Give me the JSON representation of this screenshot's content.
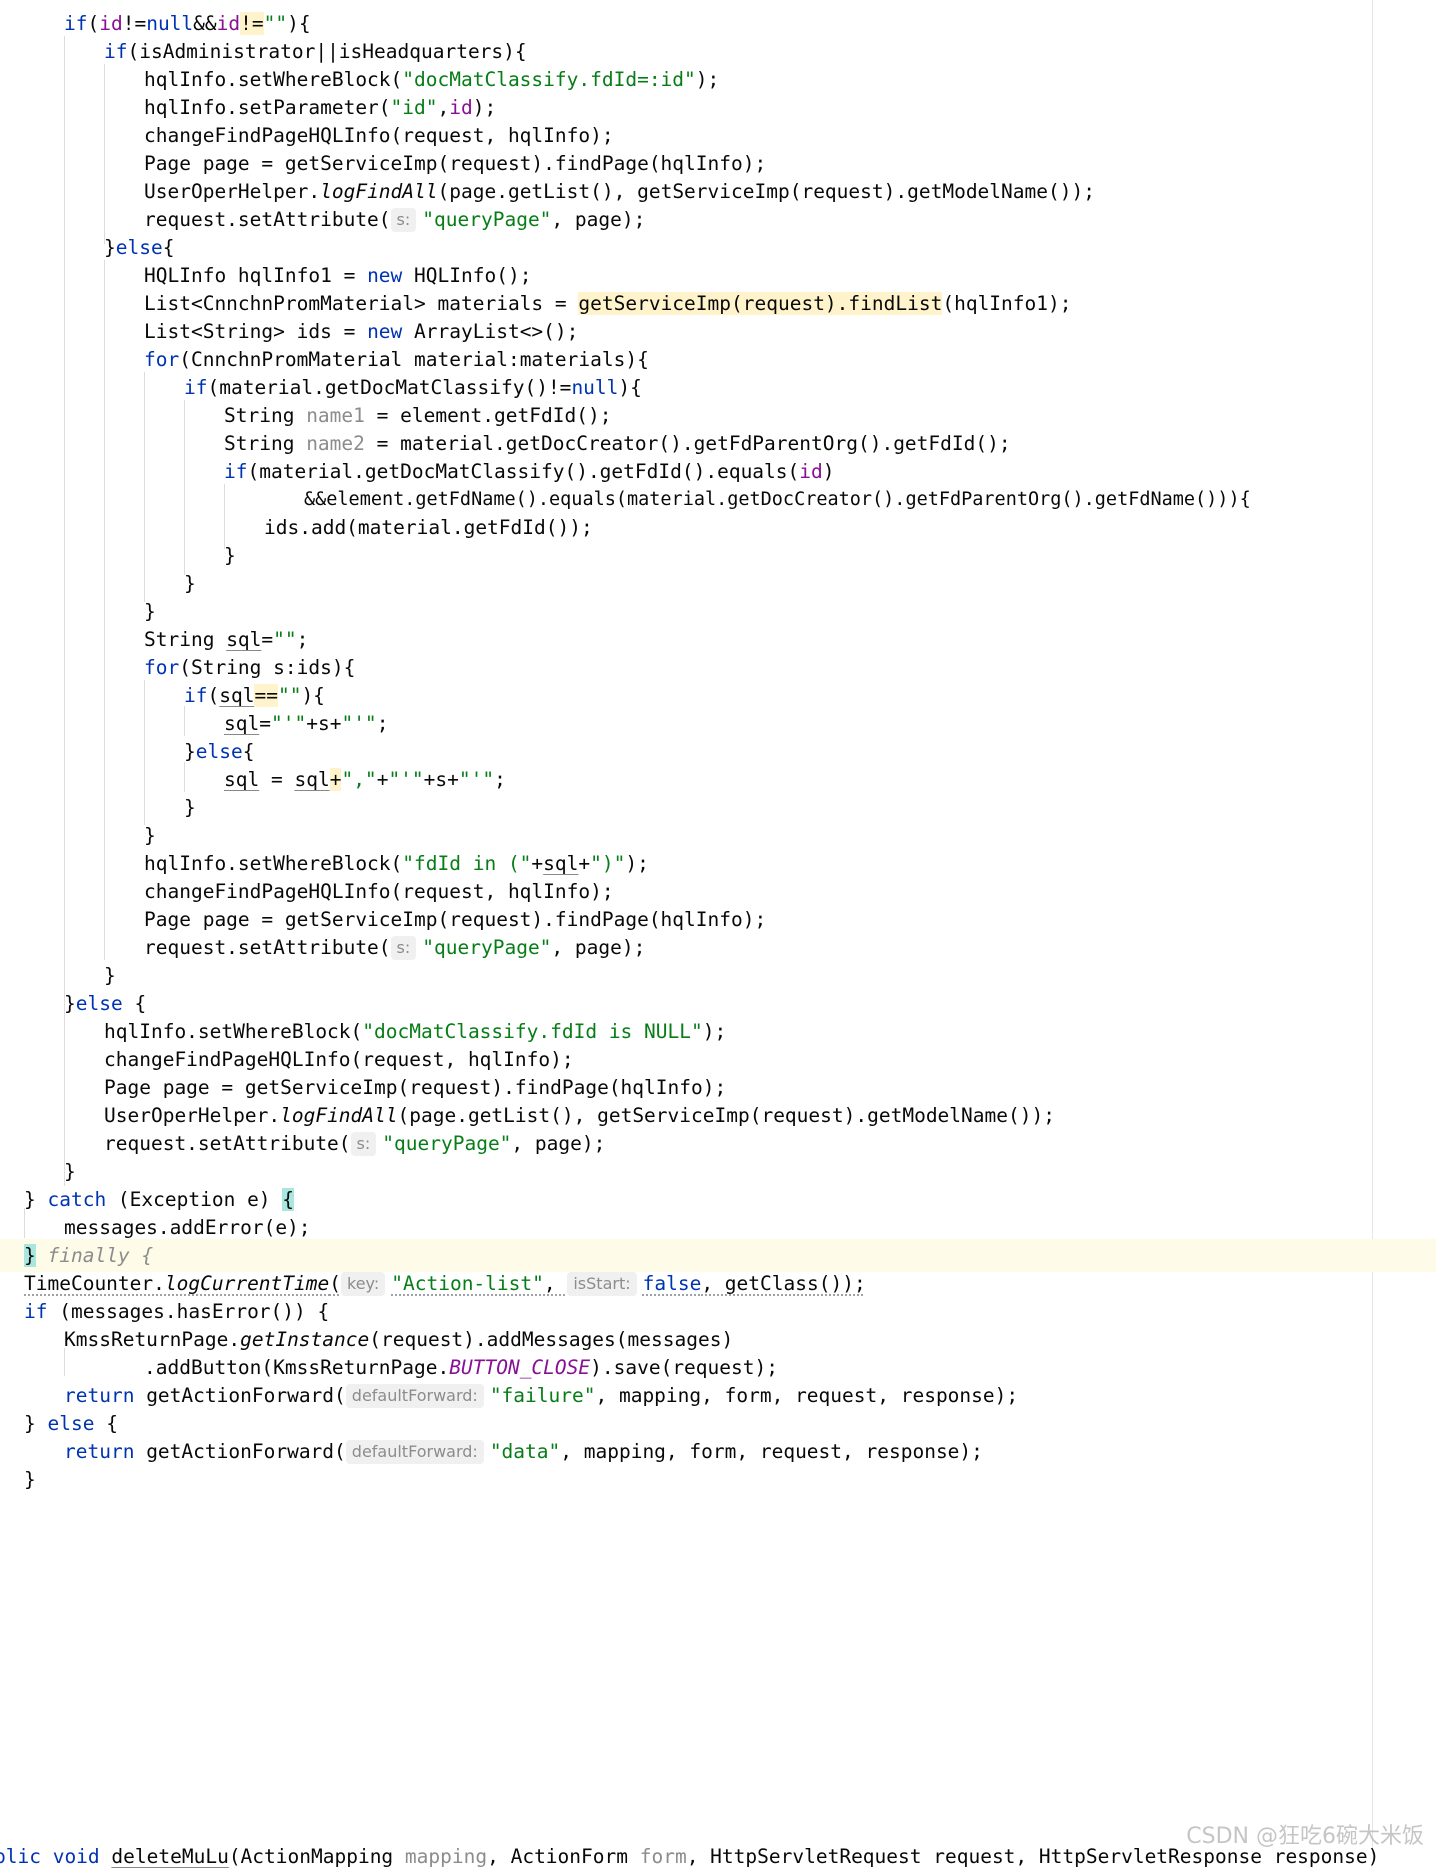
{
  "code": {
    "l0": "if(id!=null&&id!=\"\"){",
    "l1_kw": "if",
    "l1": "(isAdministrator||isHeadquarters){",
    "l2a": "hqlInfo.setWhereBlock(",
    "l2s": "\"docMatClassify.fdId=:id\"",
    "l2b": ");",
    "l3a": "hqlInfo.setParameter(",
    "l3s": "\"id\"",
    "l3b": ",",
    "l3f": "id",
    "l3c": ");",
    "l4": "changeFindPageHQLInfo(request, hqlInfo);",
    "l5": "Page page = getServiceImp(request).findPage(hqlInfo);",
    "l6a": "UserOperHelper.",
    "l6i": "logFindAll",
    "l6b": "(page.getList(), getServiceImp(request).getModelName());",
    "l7a": "request.setAttribute(",
    "l7h": "s:",
    "l7s": "\"queryPage\"",
    "l7b": ", page);",
    "l8a": "}",
    "l8k": "else",
    "l8b": "{",
    "l9a": "HQLInfo hqlInfo1 = ",
    "l9k": "new",
    "l9b": " HQLInfo();",
    "l10a": "List<CnnchnPromMaterial> materials = ",
    "l10h": "getServiceImp(request).findList",
    "l10b": "(hqlInfo1);",
    "l11a": "List<String> ids = ",
    "l11k": "new",
    "l11b": " ArrayList<>();",
    "l12k": "for",
    "l12": "(CnnchnPromMaterial material:materials){",
    "l13k": "if",
    "l13a": "(material.getDocMatClassify()!=",
    "l13n": "null",
    "l13b": "){",
    "l14a": "String ",
    "l14u": "name1",
    "l14b": " = element.getFdId();",
    "l15a": "String ",
    "l15u": "name2",
    "l15b": " = material.getDocCreator().getFdParentOrg().getFdId();",
    "l16k": "if",
    "l16a": "(material.getDocMatClassify().getFdId().equals(",
    "l16f": "id",
    "l16b": ")",
    "l17": "&&element.getFdName().equals(material.getDocCreator().getFdParentOrg().getFdName())){",
    "l18": "ids.add(material.getFdId());",
    "l19": "}",
    "l20": "}",
    "l21": "}",
    "l22a": "String ",
    "l22v": "sql",
    "l22b": "=",
    "l22s": "\"\"",
    "l22c": ";",
    "l23k": "for",
    "l23": "(String s:ids){",
    "l24k": "if",
    "l24a": "(",
    "l24v": "sql",
    "l24e": "==",
    "l24s": "\"\"",
    "l24b": "){",
    "l25v": "sql",
    "l25a": "=",
    "l25s1": "\"'\"",
    "l25b": "+s+",
    "l25s2": "\"'\"",
    "l25c": ";",
    "l26a": "}",
    "l26k": "else",
    "l26b": "{",
    "l27v": "sql",
    "l27a": " = ",
    "l27v2": "sql",
    "l27p": "+",
    "l27s1": "\",\"",
    "l27b": "+",
    "l27s2": "\"'\"",
    "l27c": "+s+",
    "l27s3": "\"'\"",
    "l27d": ";",
    "l28": "}",
    "l29": "}",
    "l30a": "hqlInfo.setWhereBlock(",
    "l30s1": "\"fdId in (\"",
    "l30b": "+",
    "l30v": "sql",
    "l30c": "+",
    "l30s2": "\")\"",
    "l30d": ");",
    "l31": "changeFindPageHQLInfo(request, hqlInfo);",
    "l32": "Page page = getServiceImp(request).findPage(hqlInfo);",
    "l33a": "request.setAttribute(",
    "l33h": "s:",
    "l33s": "\"queryPage\"",
    "l33b": ", page);",
    "l34": "}",
    "l35a": "}",
    "l35k": "else",
    "l35b": " {",
    "l36a": "hqlInfo.setWhereBlock(",
    "l36s": "\"docMatClassify.fdId is NULL\"",
    "l36b": ");",
    "l37": "changeFindPageHQLInfo(request, hqlInfo);",
    "l38": "Page page = getServiceImp(request).findPage(hqlInfo);",
    "l39a": "UserOperHelper.",
    "l39i": "logFindAll",
    "l39b": "(page.getList(), getServiceImp(request).getModelName());",
    "l40a": "request.setAttribute(",
    "l40h": "s:",
    "l40s": "\"queryPage\"",
    "l40b": ", page);",
    "l41": "}",
    "l42a": "} ",
    "l42k": "catch",
    "l42b": " (Exception e) ",
    "l42br": "{",
    "l43": "messages.addError(e);",
    "l44br": "}",
    "l44c": " finally {",
    "l45a": "TimeCounter.",
    "l45i": "logCurrentTime",
    "l45b": "(",
    "l45h1": "key:",
    "l45s": "\"Action-list\"",
    "l45c": ", ",
    "l45h2": "isStart:",
    "l45k": "false",
    "l45d": ", getClass());",
    "l46k": "if",
    "l46": " (messages.hasError()) {",
    "l47a": "KmssReturnPage.",
    "l47i": "getInstance",
    "l47b": "(request).addMessages(messages)",
    "l48a": ".addButton(KmssReturnPage.",
    "l48f": "BUTTON_CLOSE",
    "l48b": ").save(request);",
    "l49k": "return",
    "l49a": " getActionForward(",
    "l49h": "defaultForward:",
    "l49s": "\"failure\"",
    "l49b": ", mapping, form, request, response);",
    "l50a": "} ",
    "l50k": "else",
    "l50b": " {",
    "l51k": "return",
    "l51a": " getActionForward(",
    "l51h": "defaultForward:",
    "l51s": "\"data\"",
    "l51b": ", mapping, form, request, response);",
    "l52": "}",
    "l53k": "blic void ",
    "l53m": "deleteMuLu",
    "l53a": "(ActionMapping ",
    "l53u1": "mapping",
    "l53b": ", ActionForm ",
    "l53u2": "form",
    "l53c": ", HttpServletRequest request, HttpServletResponse response)"
  },
  "watermark": "CSDN @狂吃6碗大米饭"
}
